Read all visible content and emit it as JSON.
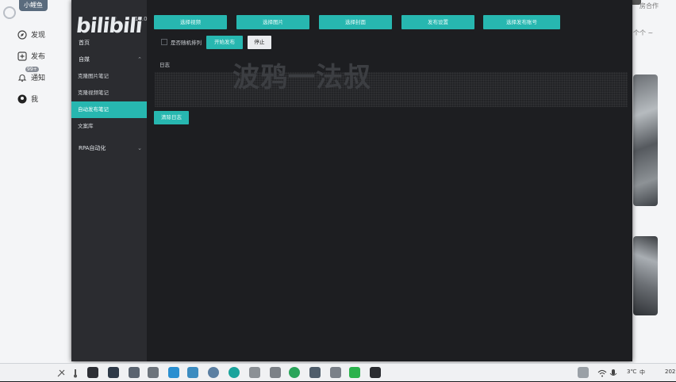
{
  "background": {
    "user_tag": "小鲤鱼",
    "nav": [
      {
        "label": "发现",
        "icon": "compass-icon"
      },
      {
        "label": "发布",
        "icon": "plus-square-icon"
      },
      {
        "label": "通知",
        "icon": "bell-icon"
      },
      {
        "label": "我",
        "icon": "user-icon"
      }
    ],
    "notif_badge": "99+",
    "right_text_1": "房合作",
    "right_text_2": "个个 ~"
  },
  "app": {
    "logo": "bilibili",
    "title_ghost": "叔",
    "version": "10.0",
    "menu": [
      {
        "label": "首页",
        "type": "item"
      },
      {
        "label": "自媒",
        "type": "group",
        "expanded": true,
        "children": [
          {
            "label": "克隆图片笔记",
            "active": false
          },
          {
            "label": "克隆视频笔记",
            "active": false
          },
          {
            "label": "自动发布笔记",
            "active": true
          },
          {
            "label": "文案库",
            "active": false
          }
        ]
      },
      {
        "label": "RPA自动化",
        "type": "group",
        "expanded": false
      }
    ],
    "top_buttons": [
      "选择视频",
      "选择图片",
      "选择封面",
      "发布设置",
      "选择发布账号"
    ],
    "checkbox_label": "是否随机排列",
    "start_label": "开始发布",
    "stop_label": "停止",
    "log_label": "日志",
    "watermark": "波鸦一法叔",
    "clear_label": "清除日志"
  },
  "taskbar": {
    "time": "202",
    "tray_text": "中"
  },
  "colors": {
    "accent": "#27b7b0",
    "window_bg": "#1d1e21",
    "sidebar_bg": "#2b2c30"
  }
}
